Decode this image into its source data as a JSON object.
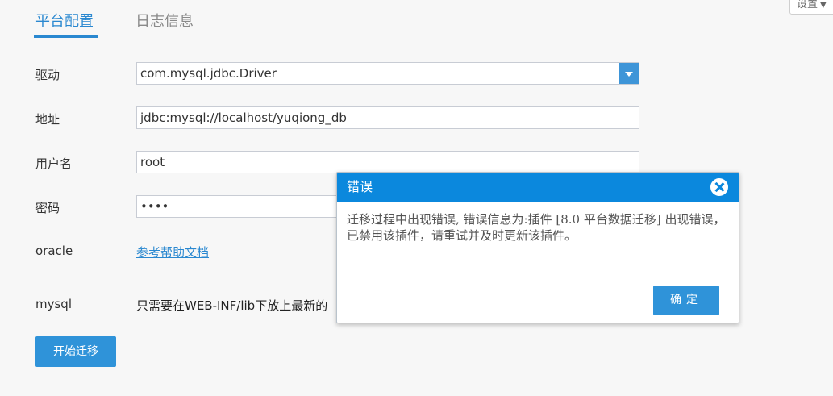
{
  "tabs": [
    {
      "label": "平台配置",
      "active": true
    },
    {
      "label": "日志信息",
      "active": false
    }
  ],
  "settings_button": {
    "label": "设置"
  },
  "form": {
    "driver": {
      "label": "驱动",
      "value": "com.mysql.jdbc.Driver"
    },
    "address": {
      "label": "地址",
      "value": "jdbc:mysql://localhost/yuqiong_db"
    },
    "username": {
      "label": "用户名",
      "value": "root"
    },
    "password": {
      "label": "密码",
      "value": "••••"
    },
    "oracle": {
      "label": "oracle",
      "link": "参考帮助文档"
    },
    "mysql": {
      "label": "mysql",
      "text": "只需要在WEB-INF/lib下放上最新的"
    }
  },
  "start_button": {
    "label": "开始迁移"
  },
  "dialog": {
    "title": "错误",
    "message": "迁移过程中出现错误, 错误信息为:插件  [8.0  平台数据迁移]  出现错误，已禁用该插件，请重试并及时更新该插件。",
    "ok_label": "确定"
  },
  "colors": {
    "accent": "#2a88d0",
    "dialog_header": "#0b88dd",
    "button": "#2f93d9"
  }
}
